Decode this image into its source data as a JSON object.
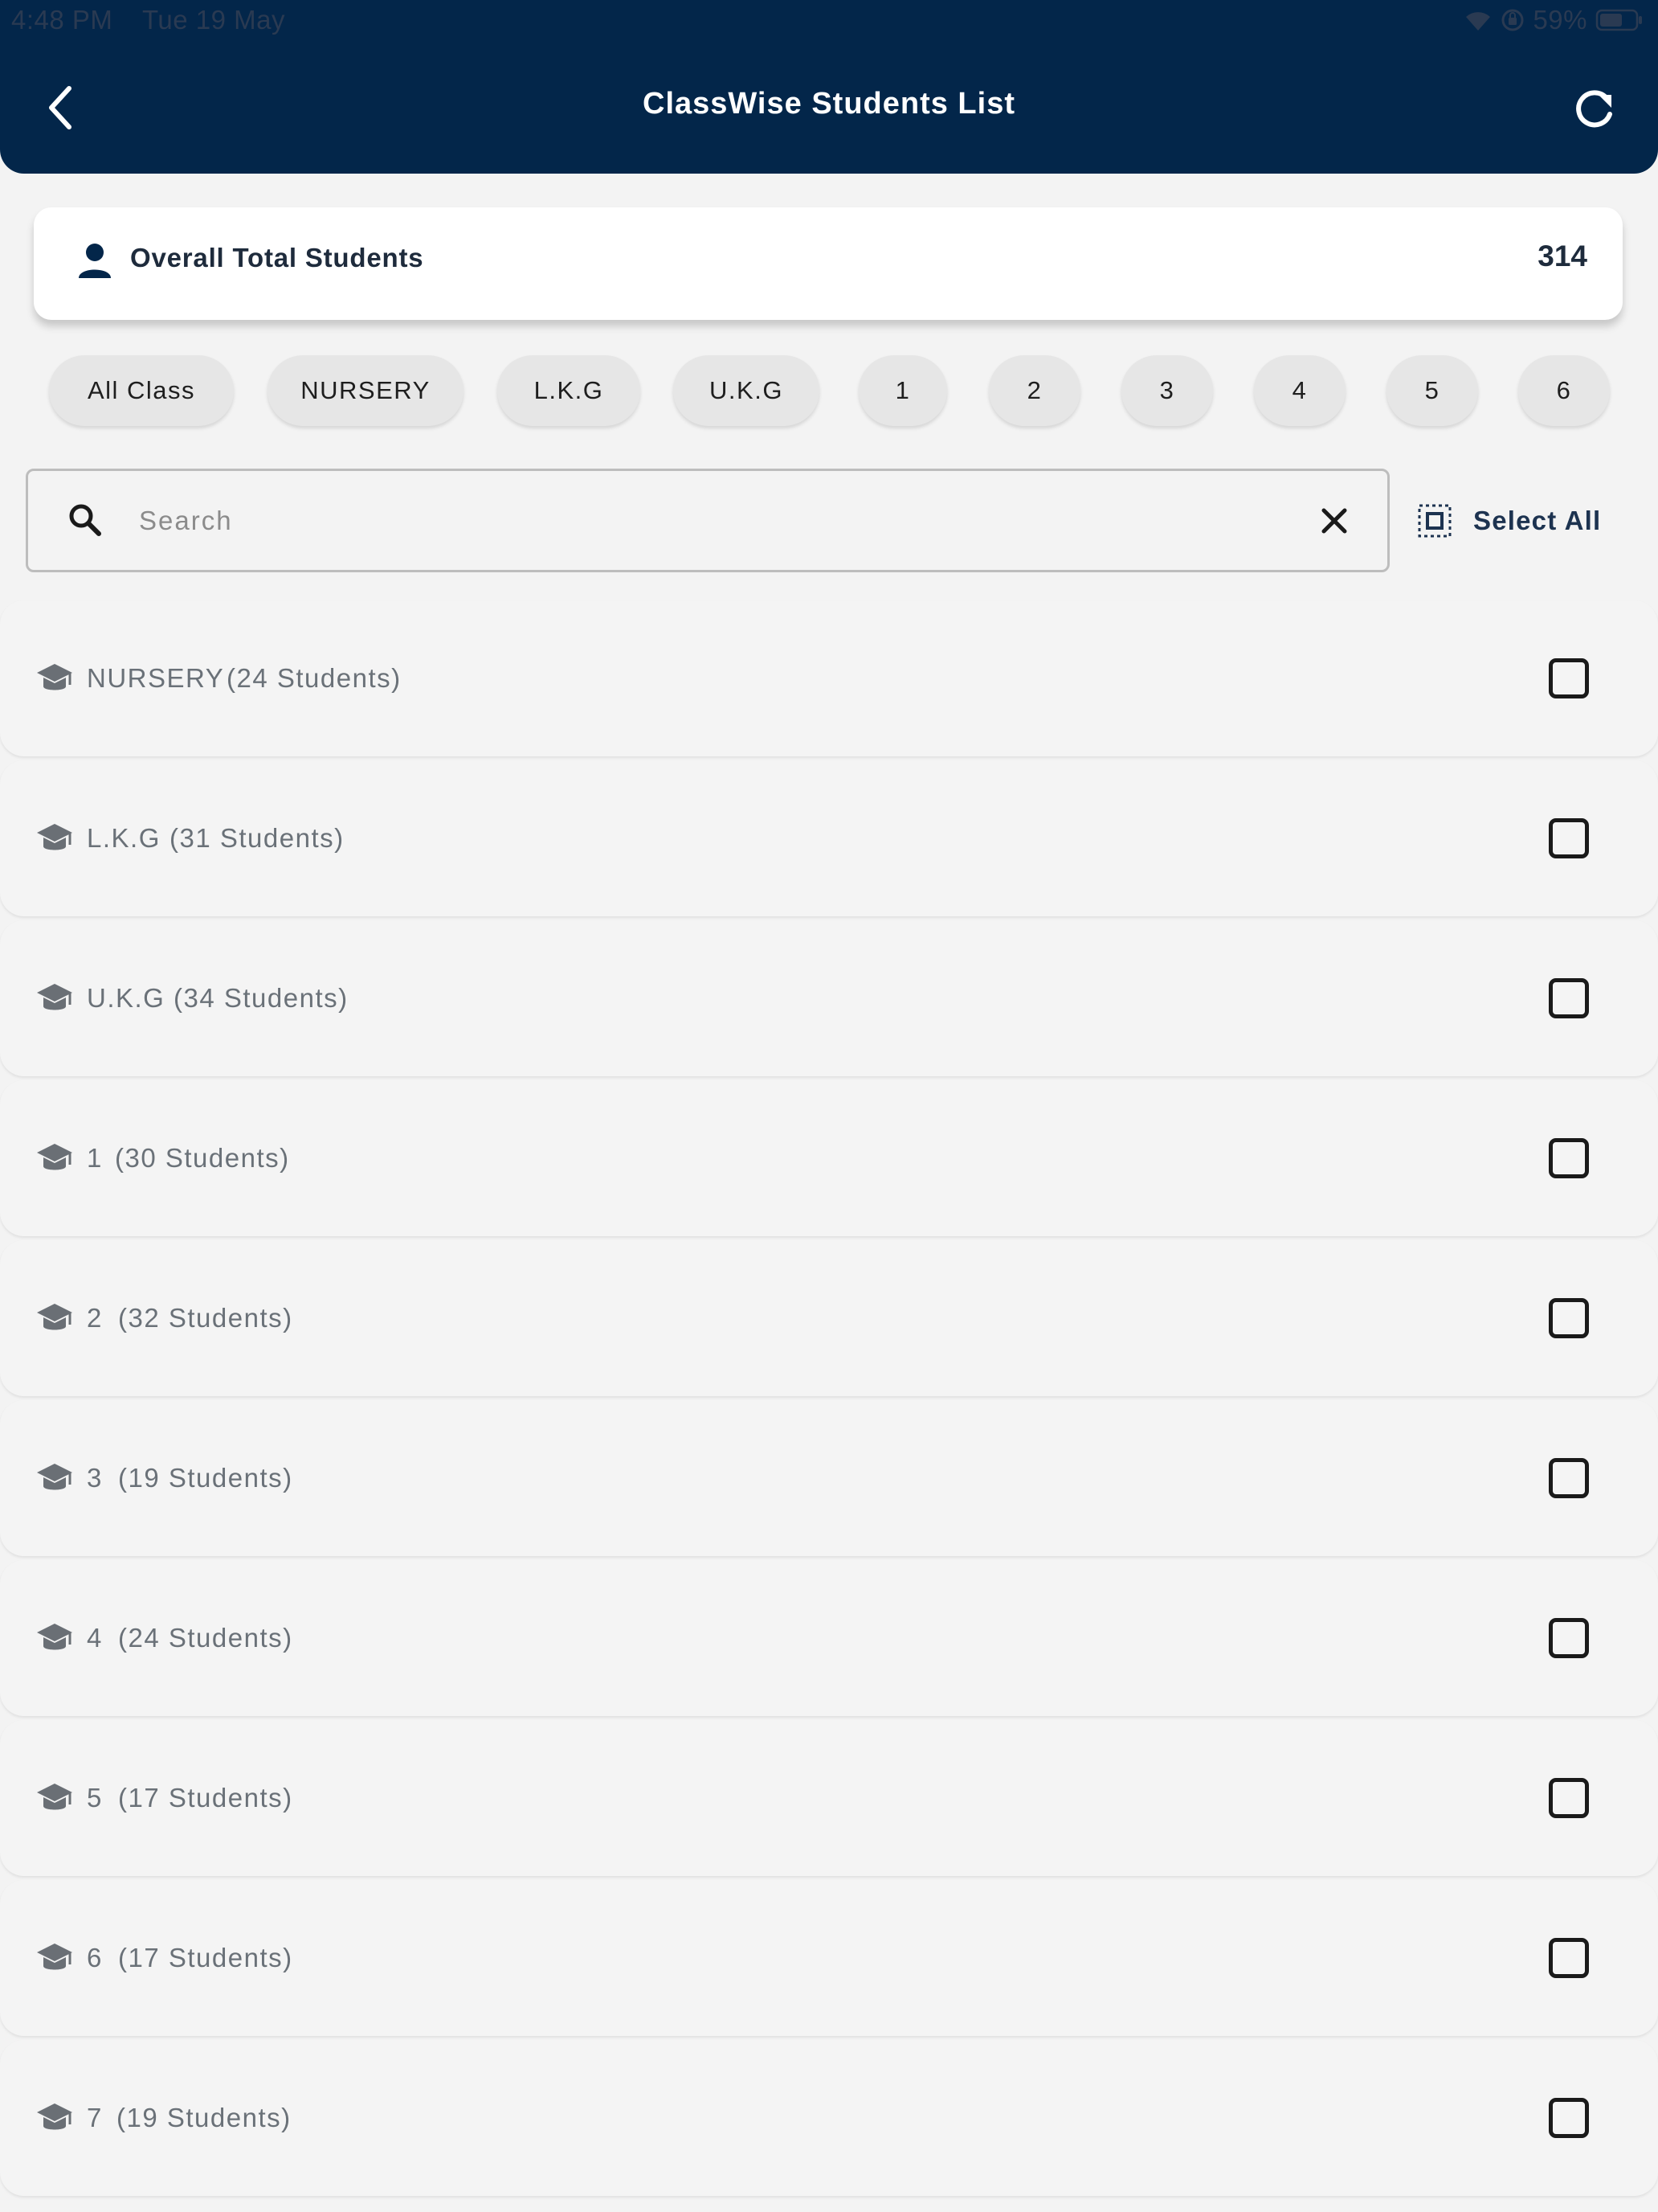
{
  "status_bar": {
    "time": "4:48 PM",
    "date": "Tue 19 May",
    "battery": "59%",
    "icons": [
      "wifi-icon",
      "orientation-lock-icon",
      "battery-icon"
    ]
  },
  "header": {
    "title": "ClassWise Students List",
    "back_icon": "chevron-left-icon",
    "refresh_icon": "refresh-icon",
    "background_color": "#03264a"
  },
  "summary": {
    "label": "Overall Total Students",
    "value": "314",
    "icon": "person-icon"
  },
  "filters": {
    "chips": [
      "All Class",
      "NURSERY",
      "L.K.G",
      "U.K.G",
      "1",
      "2",
      "3",
      "4",
      "5",
      "6"
    ]
  },
  "search": {
    "placeholder": "Search",
    "value": "",
    "clear_icon": "close-icon"
  },
  "select_all": {
    "label": "Select All",
    "icon": "select-all-icon"
  },
  "classes": [
    {
      "name": "NURSERY",
      "count": "(24 Students)",
      "checked": false
    },
    {
      "name": "L.K.G",
      "count": "(31 Students)",
      "checked": false
    },
    {
      "name": "U.K.G",
      "count": "(34 Students)",
      "checked": false
    },
    {
      "name": "1",
      "count": "(30 Students)",
      "checked": false
    },
    {
      "name": "2",
      "count": "(32 Students)",
      "checked": false
    },
    {
      "name": "3",
      "count": "(19 Students)",
      "checked": false
    },
    {
      "name": "4",
      "count": "(24 Students)",
      "checked": false
    },
    {
      "name": "5",
      "count": "(17 Students)",
      "checked": false
    },
    {
      "name": "6",
      "count": "(17 Students)",
      "checked": false
    },
    {
      "name": "7",
      "count": "(19 Students)",
      "checked": false
    }
  ]
}
